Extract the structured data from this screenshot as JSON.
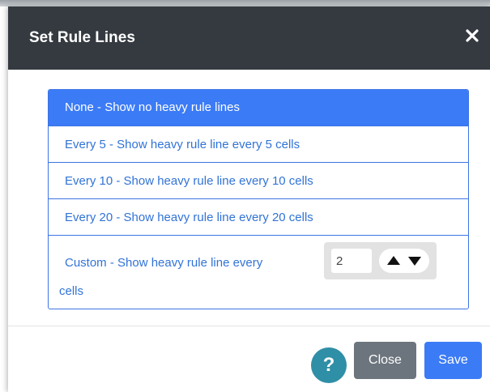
{
  "dialog": {
    "title": "Set Rule Lines",
    "close_icon": "close-icon"
  },
  "options": [
    {
      "label": "None - Show no heavy rule lines",
      "selected": true
    },
    {
      "label": "Every 5 - Show heavy rule line every 5 cells",
      "selected": false
    },
    {
      "label": "Every 10 - Show heavy rule line every 10 cells",
      "selected": false
    },
    {
      "label": "Every 20 - Show heavy rule line every 20 cells",
      "selected": false
    }
  ],
  "custom": {
    "label_before": "Custom - Show heavy rule line every",
    "label_after": "cells",
    "value": "2",
    "up_icon": "triangle-up-icon",
    "down_icon": "triangle-down-icon"
  },
  "footer": {
    "help_label": "?",
    "close_label": "Close",
    "save_label": "Save"
  },
  "colors": {
    "header_bg": "#343a40",
    "accent": "#3b7bf6",
    "link_text": "#3173d6",
    "help_bg": "#2f8fa6",
    "close_btn": "#6c757d"
  }
}
